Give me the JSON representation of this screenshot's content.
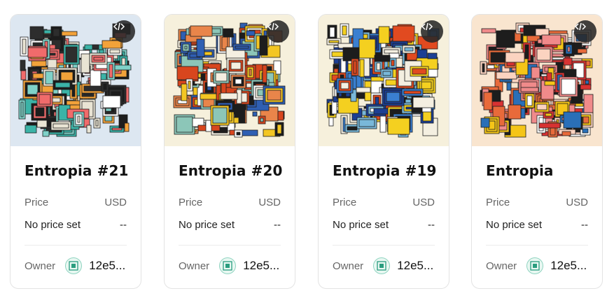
{
  "colors": {
    "card_border": "#e3e3e3",
    "bg_blue": "#dde7f1",
    "bg_cream": "#f6f0dc",
    "bg_peach": "#f9e5cf"
  },
  "cards": [
    {
      "title": "Entropia #21",
      "price_label": "Price",
      "currency": "USD",
      "price_value": "No price set",
      "currency_value": "--",
      "owner_label": "Owner",
      "owner_address": "12e5...",
      "icon": "code-icon",
      "art_theme": "teal-black"
    },
    {
      "title": "Entropia #20",
      "price_label": "Price",
      "currency": "USD",
      "price_value": "No price set",
      "currency_value": "--",
      "owner_label": "Owner",
      "owner_address": "12e5...",
      "icon": "code-icon",
      "art_theme": "warm-earth"
    },
    {
      "title": "Entropia #19",
      "price_label": "Price",
      "currency": "USD",
      "price_value": "No price set",
      "currency_value": "--",
      "owner_label": "Owner",
      "owner_address": "12e5...",
      "icon": "code-icon",
      "art_theme": "primary-blue"
    },
    {
      "title": "Entropia",
      "price_label": "Price",
      "currency": "USD",
      "price_value": "No price set",
      "currency_value": "--",
      "owner_label": "Owner",
      "owner_address": "12e5...",
      "icon": "code-icon",
      "art_theme": "red-pink"
    }
  ]
}
